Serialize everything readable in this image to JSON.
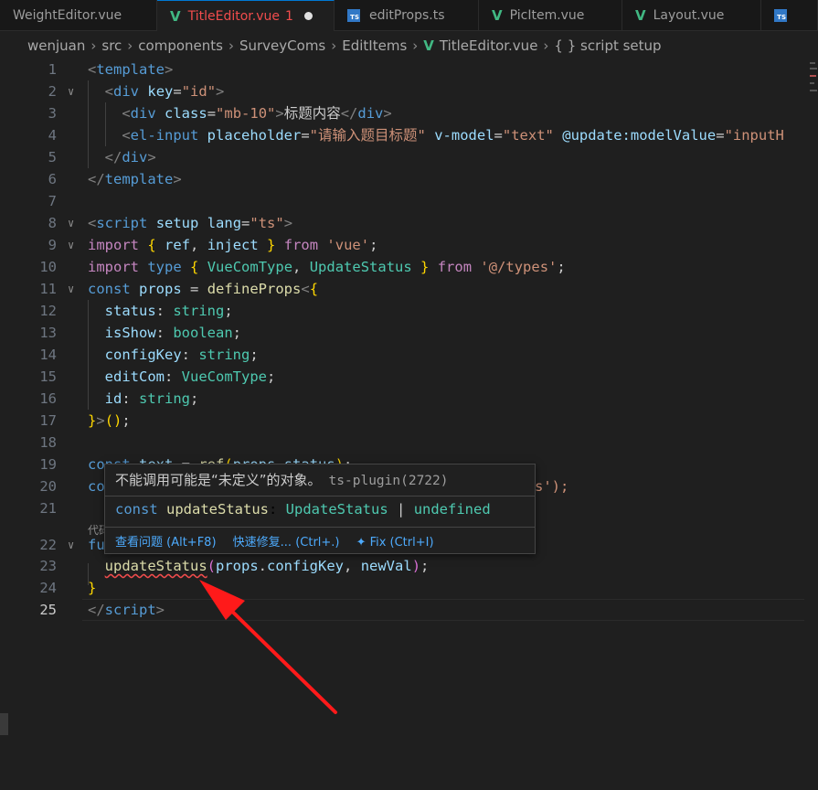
{
  "tabs": [
    {
      "label": "WeightEditor.vue",
      "icon": "vue-icon",
      "active": false
    },
    {
      "label": "TitleEditor.vue",
      "badge": "1",
      "icon": "vue-icon",
      "active": true,
      "dirty": true
    },
    {
      "label": "editProps.ts",
      "icon": "ts-icon",
      "active": false
    },
    {
      "label": "PicItem.vue",
      "icon": "vue-icon",
      "active": false
    },
    {
      "label": "Layout.vue",
      "icon": "vue-icon",
      "active": false
    }
  ],
  "breadcrumb": [
    "wenjuan",
    "src",
    "components",
    "SurveyComs",
    "EditItems",
    "TitleEditor.vue",
    "{ } script setup"
  ],
  "editor": {
    "current_line": "25",
    "line_numbers": [
      "1",
      "2",
      "3",
      "4",
      "5",
      "6",
      "7",
      "8",
      "9",
      "10",
      "11",
      "12",
      "13",
      "14",
      "15",
      "16",
      "17",
      "18",
      "19",
      "20",
      "21",
      "22",
      "23",
      "24",
      "25"
    ]
  },
  "code": {
    "l3_text": "标题内容",
    "l4_placeholder": "请输入题目标题",
    "l20_tail": "atus');",
    "ghost_chinese": "代码"
  },
  "hover": {
    "message": "不能调用可能是“未定义”的对象。",
    "source": "ts-plugin(2722)",
    "signature_keyword": "const",
    "signature_name": "updateStatus",
    "signature_type": "UpdateStatus",
    "signature_union": "|",
    "signature_undefined": "undefined",
    "action_view_problem": "查看问题 (Alt+F8)",
    "action_quick_fix": "快速修复... (Ctrl+.)",
    "action_fix": "Fix (Ctrl+I)"
  },
  "colors": {
    "background": "#1f1f1f",
    "annotation_arrow": "#ff1a1a",
    "error_squiggle": "#f14c4c"
  }
}
